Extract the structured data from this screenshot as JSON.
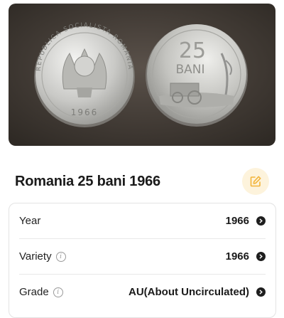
{
  "coin": {
    "title": "Romania 25 bani 1966",
    "obverse_legend": "REPUBLICA SOCIALISTA ROMANIA",
    "obverse_year": "1966",
    "reverse_value": "25",
    "reverse_unit": "BANI"
  },
  "details": [
    {
      "label": "Year",
      "value": "1966",
      "info": false
    },
    {
      "label": "Variety",
      "value": "1966",
      "info": true
    },
    {
      "label": "Grade",
      "value": "AU(About Uncirculated)",
      "info": true
    }
  ],
  "colors": {
    "accent": "#f2b43a",
    "accent_bg": "#fdf3dc",
    "photo_bg": "#3d3731"
  },
  "icons": {
    "edit": "edit-icon",
    "info": "info-icon",
    "chevron": "chevron-right-icon"
  }
}
